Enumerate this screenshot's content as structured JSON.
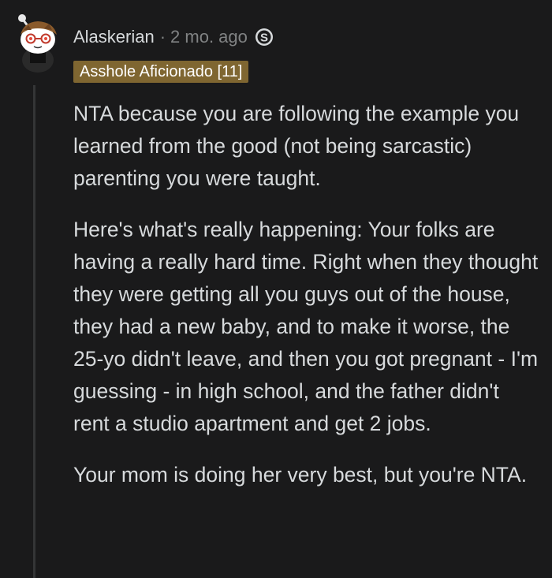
{
  "comment": {
    "username": "Alaskerian",
    "separator": "·",
    "timestamp": "2 mo. ago",
    "award_icon": "silver-award-icon",
    "flair": "Asshole Aficionado [11]",
    "paragraphs": [
      "NTA because you are following the example you learned from the good (not being sarcastic) parenting you were taught.",
      "Here's what's really happening: Your folks are having a really hard time. Right when they thought they were getting all you guys out of the house, they had a new baby, and to make it worse, the 25-yo didn't leave, and then you got pregnant - I'm guessing - in high school, and the father didn't rent a studio apartment and get 2 jobs.",
      "Your mom is doing her very best, but you're NTA."
    ]
  },
  "colors": {
    "background": "#1a1a1b",
    "text": "#d7dadc",
    "meta": "#818384",
    "flair_bg": "#7f6631",
    "thread_line": "#343536"
  }
}
